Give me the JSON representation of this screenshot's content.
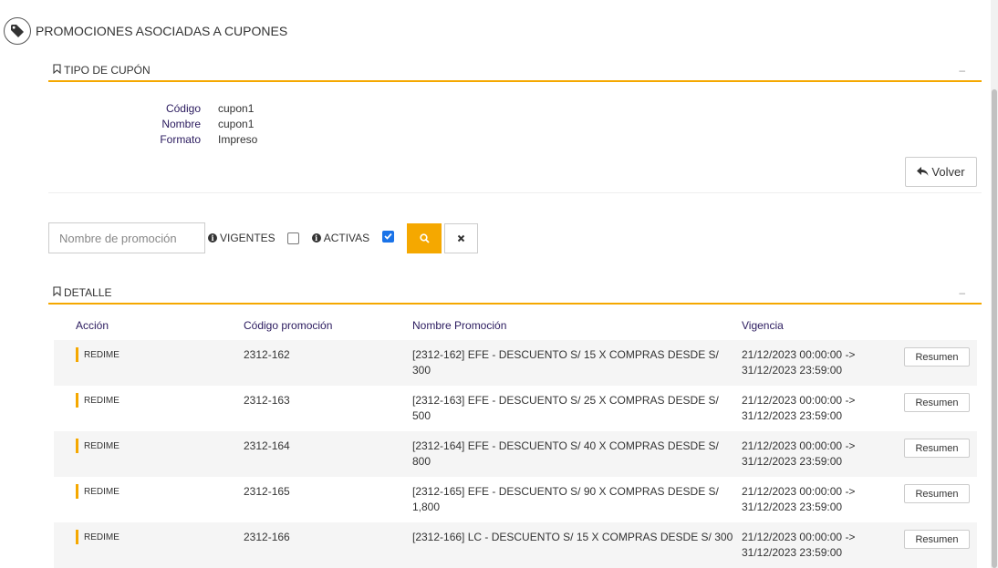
{
  "header": {
    "title": "PROMOCIONES ASOCIADAS A CUPONES",
    "icon": "tag-icon"
  },
  "coupon_section": {
    "title": "TIPO DE CUPÓN",
    "collapse": "–",
    "fields": [
      {
        "label": "Código",
        "value": "cupon1"
      },
      {
        "label": "Nombre",
        "value": "cupon1"
      },
      {
        "label": "Formato",
        "value": "Impreso"
      }
    ],
    "back_label": "Volver"
  },
  "filter": {
    "search_placeholder": "Nombre de promoción",
    "search_value": "",
    "vigentes_label": "VIGENTES",
    "vigentes_checked": false,
    "activas_label": "ACTIVAS",
    "activas_checked": true
  },
  "detail_section": {
    "title": "DETALLE",
    "collapse": "–",
    "columns": [
      "Acción",
      "Código promoción",
      "Nombre Promoción",
      "Vigencia"
    ],
    "rows": [
      {
        "action": "REDIME",
        "code": "2312-162",
        "name": "[2312-162] EFE - DESCUENTO S/ 15 X COMPRAS DESDE S/ 300",
        "validity": "21/12/2023 00:00:00 -> 31/12/2023 23:59:00",
        "button": "Resumen"
      },
      {
        "action": "REDIME",
        "code": "2312-163",
        "name": "[2312-163] EFE - DESCUENTO S/ 25 X COMPRAS DESDE S/ 500",
        "validity": "21/12/2023 00:00:00 -> 31/12/2023 23:59:00",
        "button": "Resumen"
      },
      {
        "action": "REDIME",
        "code": "2312-164",
        "name": "[2312-164] EFE - DESCUENTO S/ 40 X COMPRAS DESDE S/ 800",
        "validity": "21/12/2023 00:00:00 -> 31/12/2023 23:59:00",
        "button": "Resumen"
      },
      {
        "action": "REDIME",
        "code": "2312-165",
        "name": "[2312-165] EFE - DESCUENTO S/ 90 X COMPRAS DESDE S/ 1,800",
        "validity": "21/12/2023 00:00:00 -> 31/12/2023 23:59:00",
        "button": "Resumen"
      },
      {
        "action": "REDIME",
        "code": "2312-166",
        "name": "[2312-166] LC - DESCUENTO S/ 15 X COMPRAS DESDE S/ 300",
        "validity": "21/12/2023 00:00:00 -> 31/12/2023 23:59:00",
        "button": "Resumen"
      }
    ]
  },
  "colors": {
    "accent": "#f5a800",
    "label": "#2a1a5e",
    "checkbox": "#1a73e8"
  }
}
